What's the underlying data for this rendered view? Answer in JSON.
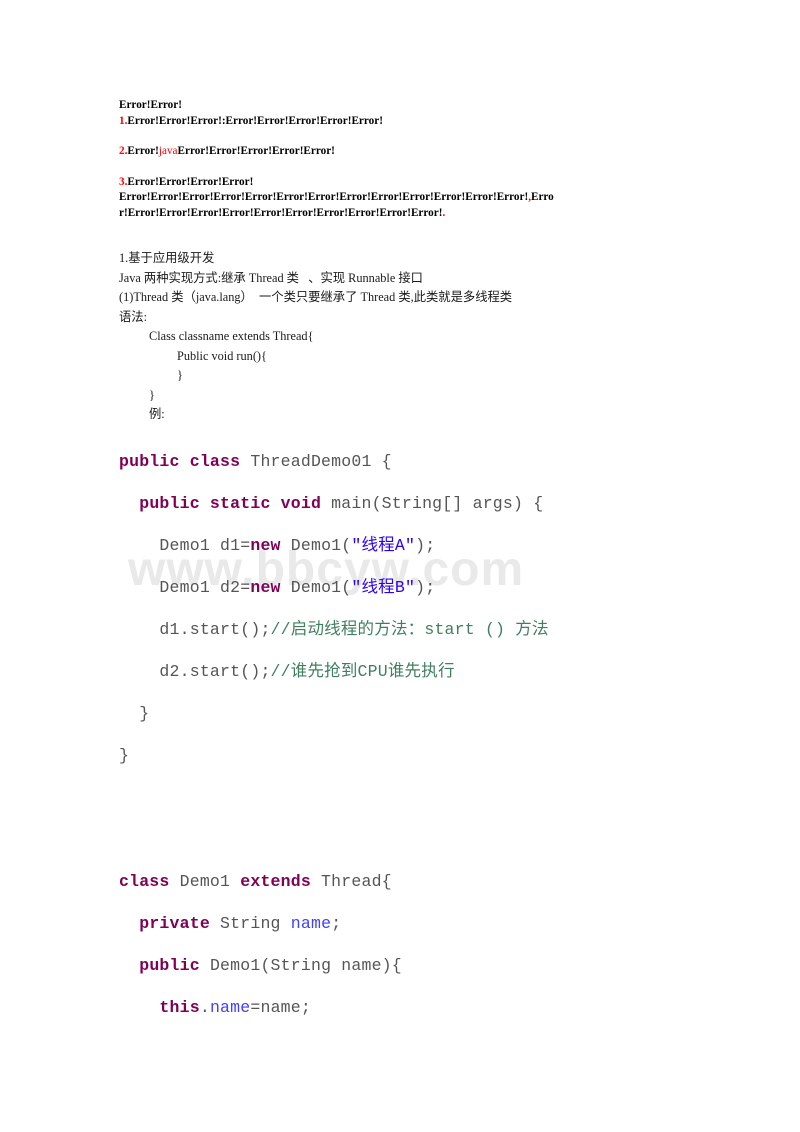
{
  "document": {
    "watermark": "www.bbcyw.com",
    "colors": {
      "keyword": "#7f0055",
      "string": "#2a00ff",
      "comment": "#3f7f5f",
      "field": "#4040ff",
      "plain": "#555555",
      "error_red": "#ff0000",
      "text": "#000000",
      "background": "#ffffff"
    }
  },
  "error_block": {
    "title": "Error!Error!",
    "items": [
      {
        "number": "1.",
        "text": "Error!Error!Error!:Error!Error!Error!Error!Error!"
      },
      {
        "number": "2.",
        "prefix": "Error!",
        "highlight": "java",
        "suffix": "Error!Error!Error!Error!Error!"
      },
      {
        "number": "3.",
        "text": "Error!Error!Error!Error!"
      }
    ],
    "paragraph_line1": "Error!Error!Error!Error!Error!Error!Error!Error!Error!Error!Error!Error!Error!",
    "paragraph_comma": ",",
    "paragraph_line1_tail": "Erro",
    "paragraph_line2": "r!Error!Error!Error!Error!Error!Error!Error!Error!Error!Error!",
    "paragraph_period": "."
  },
  "body": {
    "lines": [
      {
        "text": "1.基于应用级开发",
        "indent": 0
      },
      {
        "text": "Java 两种实现方式:继承 Thread 类   、实现 Runnable 接口",
        "indent": 0
      },
      {
        "text": "(1)Thread 类（java.lang）  一个类只要继承了 Thread 类,此类就是多线程类",
        "indent": 0
      },
      {
        "text": "语法:",
        "indent": 0
      },
      {
        "text": "Class classname extends Thread{",
        "indent": 1
      },
      {
        "text": "Public void run(){",
        "indent": 2
      },
      {
        "text": "",
        "indent": 0
      },
      {
        "text": "}",
        "indent": 2
      },
      {
        "text": "}",
        "indent": 1
      },
      {
        "text": "例:",
        "indent": 1
      }
    ]
  },
  "code": {
    "line1": {
      "kw1": "public class",
      "rest": " ThreadDemo01 {"
    },
    "line2": {
      "indent": "  ",
      "kw1": "public static void",
      "rest": " main(String[] args) {"
    },
    "line3": {
      "indent": "    ",
      "pre": "Demo1 d1=",
      "kw": "new",
      "mid": " Demo1(",
      "str": "\"线程A\"",
      "post": ");"
    },
    "line4": {
      "indent": "    ",
      "pre": "Demo1 d2=",
      "kw": "new",
      "mid": " Demo1(",
      "str": "\"线程B\"",
      "post": ");"
    },
    "line5": {
      "indent": "    ",
      "pre": "d1.start();",
      "cmt": "//启动线程的方法：start () 方法"
    },
    "line6": {
      "indent": "    ",
      "pre": "d2.start();",
      "cmt": "//谁先抢到CPU谁先执行"
    },
    "line7": {
      "indent": "  ",
      "rest": "}"
    },
    "line8": {
      "indent": "",
      "rest": "}"
    },
    "line9": {
      "kw1": "class",
      "mid": " Demo1 ",
      "kw2": "extends",
      "rest": " Thread{"
    },
    "line10": {
      "indent": "  ",
      "kw": "private",
      "mid": " String ",
      "fld": "name",
      "post": ";"
    },
    "line11": {
      "indent": "  ",
      "kw": "public",
      "rest": " Demo1(String name){"
    },
    "line12": {
      "indent": "    ",
      "kw": "this",
      "dot": ".",
      "fld": "name",
      "post": "=name;"
    }
  }
}
